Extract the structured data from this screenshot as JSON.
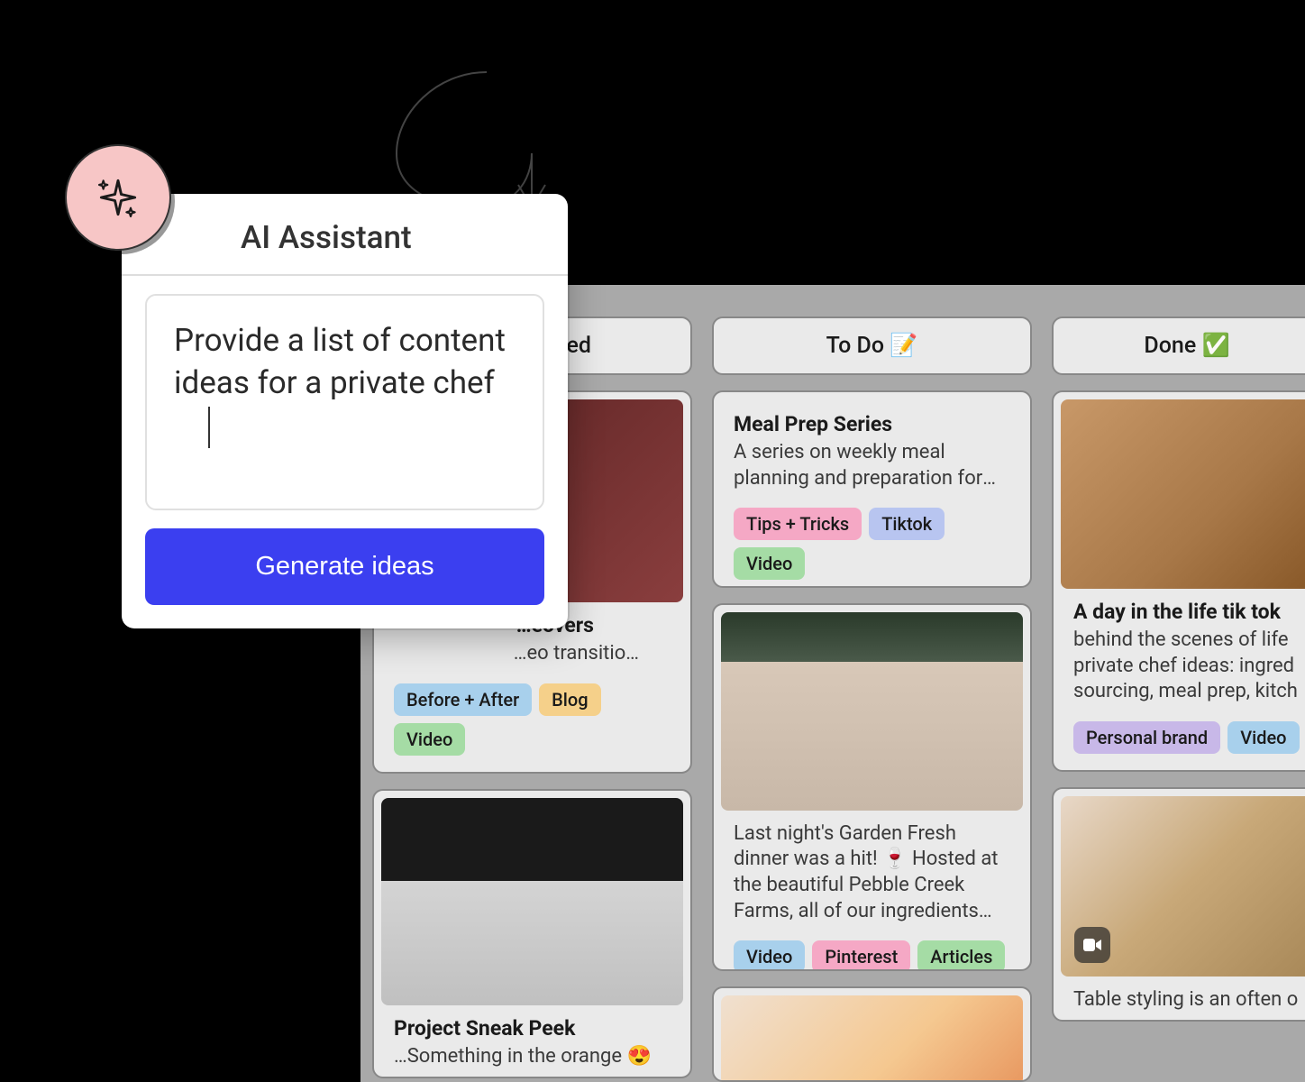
{
  "ai_assistant": {
    "title": "AI Assistant",
    "prompt": "Provide a list of content ideas for a private chef",
    "button_label": "Generate ideas"
  },
  "board": {
    "columns": [
      {
        "id": "planned",
        "header": "…ned",
        "cards": [
          {
            "title": "…eovers",
            "desc": "…eo transitio…",
            "tags": [
              {
                "label": "Before + After",
                "color": "blue"
              },
              {
                "label": "Blog",
                "color": "yellow"
              },
              {
                "label": "Video",
                "color": "green"
              }
            ],
            "image": "cocktail"
          },
          {
            "title": "Project Sneak Peek",
            "desc": "…Something in the orange 😍",
            "tags": [],
            "image": "pasta"
          }
        ]
      },
      {
        "id": "todo",
        "header": "To Do 📝",
        "cards": [
          {
            "title": "Meal Prep Series",
            "desc": "A series on weekly meal planning and preparation for busy people.",
            "tags": [
              {
                "label": "Tips + Tricks",
                "color": "pink"
              },
              {
                "label": "Tiktok",
                "color": "periwinkle"
              },
              {
                "label": "Video",
                "color": "green"
              }
            ],
            "image": null
          },
          {
            "title": "",
            "desc": "Last night's Garden Fresh dinner was a hit! 🍷 Hosted at the beautiful Pebble Creek Farms, all of our ingredients were sourced fresh fro…",
            "tags": [
              {
                "label": "Video",
                "color": "blue"
              },
              {
                "label": "Pinterest",
                "color": "pink"
              },
              {
                "label": "Articles",
                "color": "green"
              }
            ],
            "image": "dinner"
          },
          {
            "title": "",
            "desc": "",
            "tags": [],
            "image": "peaches"
          }
        ]
      },
      {
        "id": "done",
        "header": "Done ✅",
        "cards": [
          {
            "title": "A day in the life tik tok",
            "desc": "behind the scenes of life private chef ideas: ingred sourcing, meal prep, kitch",
            "tags": [
              {
                "label": "Personal brand",
                "color": "purple"
              },
              {
                "label": "Video",
                "color": "blue"
              }
            ],
            "image": "whisk"
          },
          {
            "title": "",
            "desc": "Table styling is an often o",
            "tags": [],
            "image": "toast",
            "video": true
          }
        ]
      }
    ]
  }
}
